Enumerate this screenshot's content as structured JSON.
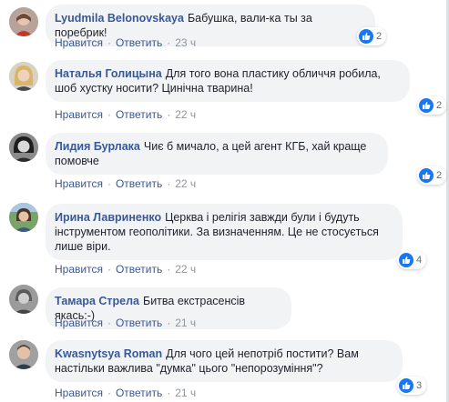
{
  "colors": {
    "author": "#385898",
    "bubble": "#f2f3f5",
    "like_badge": "#1877f2",
    "meta": "#90949c"
  },
  "labels": {
    "like": "Нравится",
    "reply": "Ответить",
    "separator": "·"
  },
  "comments": [
    {
      "author": "Lyudmila Belonovskaya",
      "text": "Бабушка, вали-ка ты за поребрик!",
      "time": "23 ч",
      "likes": "2",
      "avatar_icon": "woman-photo-avatar"
    },
    {
      "author": "Наталья Голицына",
      "text": "Для того вона пластику обличчя робила, шоб хустку носити? Цинічна тварина!",
      "time": "22 ч",
      "likes": "2",
      "avatar_icon": "woman-blonde-photo-avatar"
    },
    {
      "author": "Лидия Бурлака",
      "text": "Чиє б мичало, а цей агент КГБ, хай краще помовче",
      "time": "22 ч",
      "likes": "2",
      "avatar_icon": "woman-dark-hair-photo-avatar"
    },
    {
      "author": "Ирина Лавриненко",
      "text": "Церква і релігія завжди були і будуть інструментом геополітики. За визначенням. Це не стосується лише віри.",
      "time": "22 ч",
      "likes": "4",
      "avatar_icon": "woman-outdoor-photo-avatar"
    },
    {
      "author": "Тамара Стрела",
      "text": "Битва екстрасенсів якась:-)",
      "time": "21 ч",
      "likes": "",
      "avatar_icon": "woman-gray-photo-avatar"
    },
    {
      "author": "Kwasnytsya Roman",
      "text": "Для чого цей непотріб постити? Вам настільки важлива \"думка\" цього \"непорозуміння\"?",
      "time": "21 ч",
      "likes": "3",
      "avatar_icon": "man-photo-avatar"
    }
  ]
}
